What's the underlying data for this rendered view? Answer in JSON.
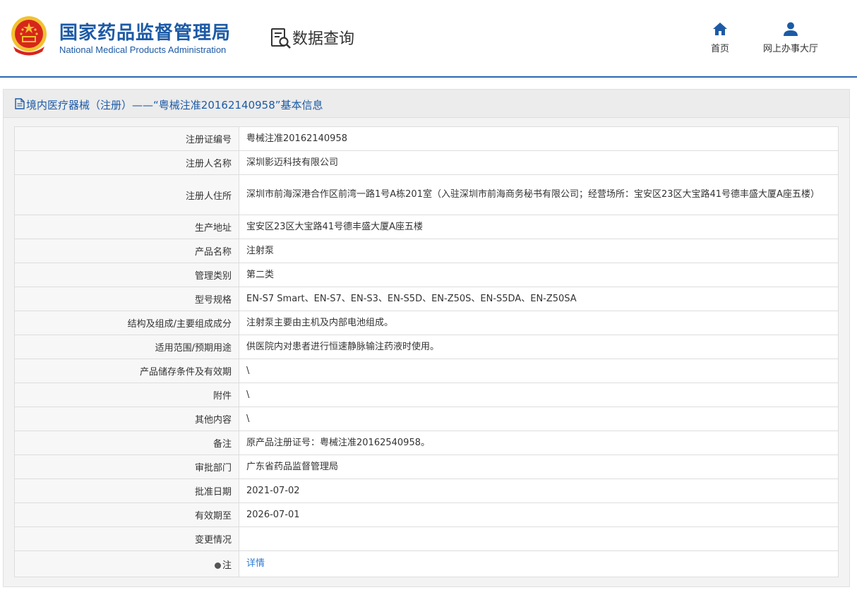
{
  "header": {
    "logo_cn": "国家药品监督管理局",
    "logo_en": "National Medical Products Administration",
    "query_label": "数据查询",
    "nav": [
      {
        "label": "首页",
        "icon": "home-icon"
      },
      {
        "label": "网上办事大厅",
        "icon": "user-icon"
      }
    ]
  },
  "panel": {
    "title": "境内医疗器械（注册）——“粤械注准20162140958”基本信息"
  },
  "rows": [
    {
      "label": "注册证编号",
      "value": "粤械注准20162140958"
    },
    {
      "label": "注册人名称",
      "value": "深圳影迈科技有限公司"
    },
    {
      "label": "注册人住所",
      "value": "深圳市前海深港合作区前湾一路1号A栋201室（入驻深圳市前海商务秘书有限公司；经营场所：宝安区23区大宝路41号德丰盛大厦A座五楼）"
    },
    {
      "label": "生产地址",
      "value": "宝安区23区大宝路41号德丰盛大厦A座五楼"
    },
    {
      "label": "产品名称",
      "value": "注射泵"
    },
    {
      "label": "管理类别",
      "value": "第二类"
    },
    {
      "label": "型号规格",
      "value": "EN-S7 Smart、EN-S7、EN-S3、EN-S5D、EN-Z50S、EN-S5DA、EN-Z50SA"
    },
    {
      "label": "结构及组成/主要组成成分",
      "value": "注射泵主要由主机及内部电池组成。"
    },
    {
      "label": "适用范围/预期用途",
      "value": "供医院内对患者进行恒速静脉输注药液时使用。"
    },
    {
      "label": "产品储存条件及有效期",
      "value": "\\"
    },
    {
      "label": "附件",
      "value": "\\"
    },
    {
      "label": "其他内容",
      "value": "\\"
    },
    {
      "label": "备注",
      "value": "原产品注册证号：粤械注准20162540958。"
    },
    {
      "label": "审批部门",
      "value": "广东省药品监督管理局"
    },
    {
      "label": "批准日期",
      "value": "2021-07-02"
    },
    {
      "label": "有效期至",
      "value": "2026-07-01"
    },
    {
      "label": "变更情况",
      "value": ""
    },
    {
      "label": "注",
      "value": "详情"
    }
  ],
  "colors": {
    "brand_blue": "#1c5aa6",
    "link_blue": "#2c7bd6",
    "emblem_red": "#d7261c",
    "emblem_gold": "#f2c230"
  }
}
